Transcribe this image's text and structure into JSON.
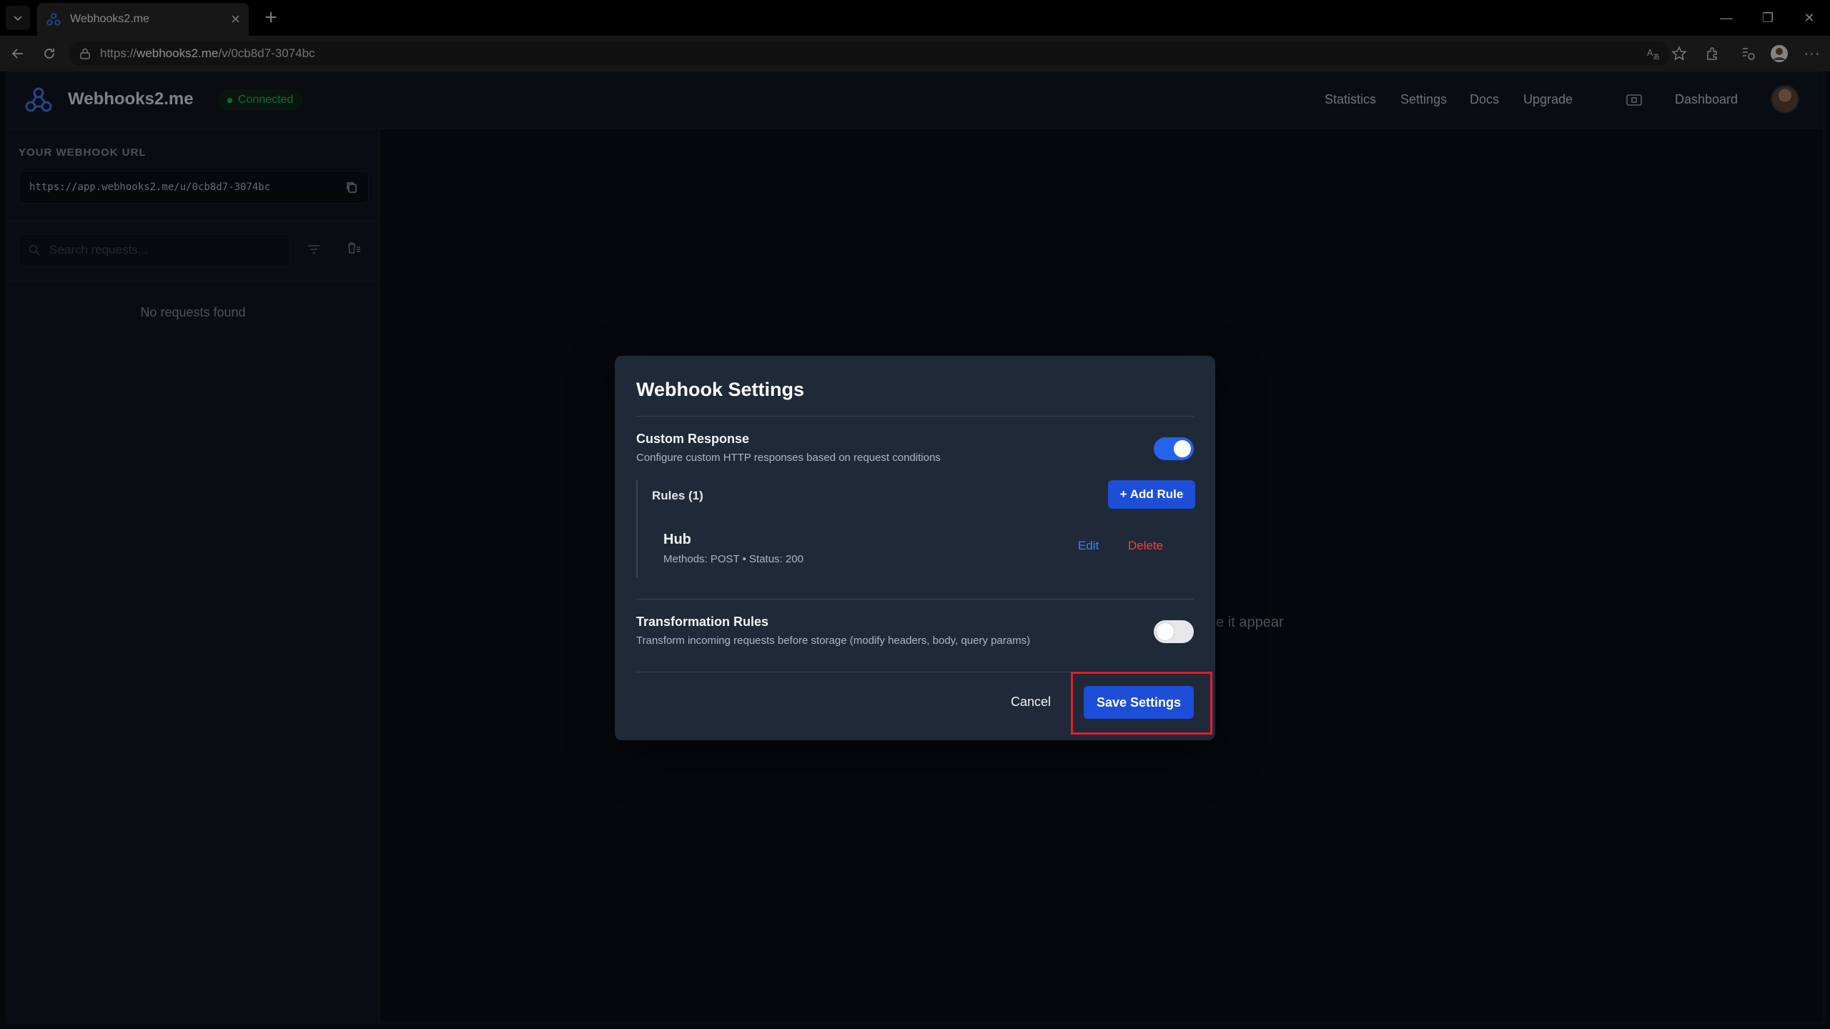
{
  "browser": {
    "tab_title": "Webhooks2.me",
    "url_prefix": "https://",
    "url_host": "webhooks2.me",
    "url_path": "/v/0cb8d7-3074bc"
  },
  "header": {
    "brand": "Webhooks2.me",
    "status": "Connected",
    "nav": [
      "Statistics",
      "Settings",
      "Docs",
      "Upgrade"
    ],
    "dashboard": "Dashboard"
  },
  "sidebar": {
    "url_label": "YOUR WEBHOOK URL",
    "webhook_url": "https://app.webhooks2.me/u/0cb8d7-3074bc",
    "search_placeholder": "Search requests...",
    "empty_text": "No requests found"
  },
  "background_hint": "ee it appear",
  "modal": {
    "title": "Webhook Settings",
    "custom_response": {
      "title": "Custom Response",
      "description": "Configure custom HTTP responses based on request conditions",
      "enabled": true
    },
    "rules": {
      "title": "Rules (1)",
      "add_label": "+ Add Rule",
      "items": [
        {
          "name": "Hub",
          "meta": "Methods: POST • Status: 200",
          "edit": "Edit",
          "delete": "Delete"
        }
      ]
    },
    "transformation": {
      "title": "Transformation Rules",
      "description": "Transform incoming requests before storage (modify headers, body, query params)",
      "enabled": false
    },
    "cancel_label": "Cancel",
    "save_label": "Save Settings"
  },
  "colors": {
    "accent": "#1d4ed8",
    "connected": "#22c55e",
    "danger": "#ef4444",
    "highlight": "#e11d2a"
  }
}
